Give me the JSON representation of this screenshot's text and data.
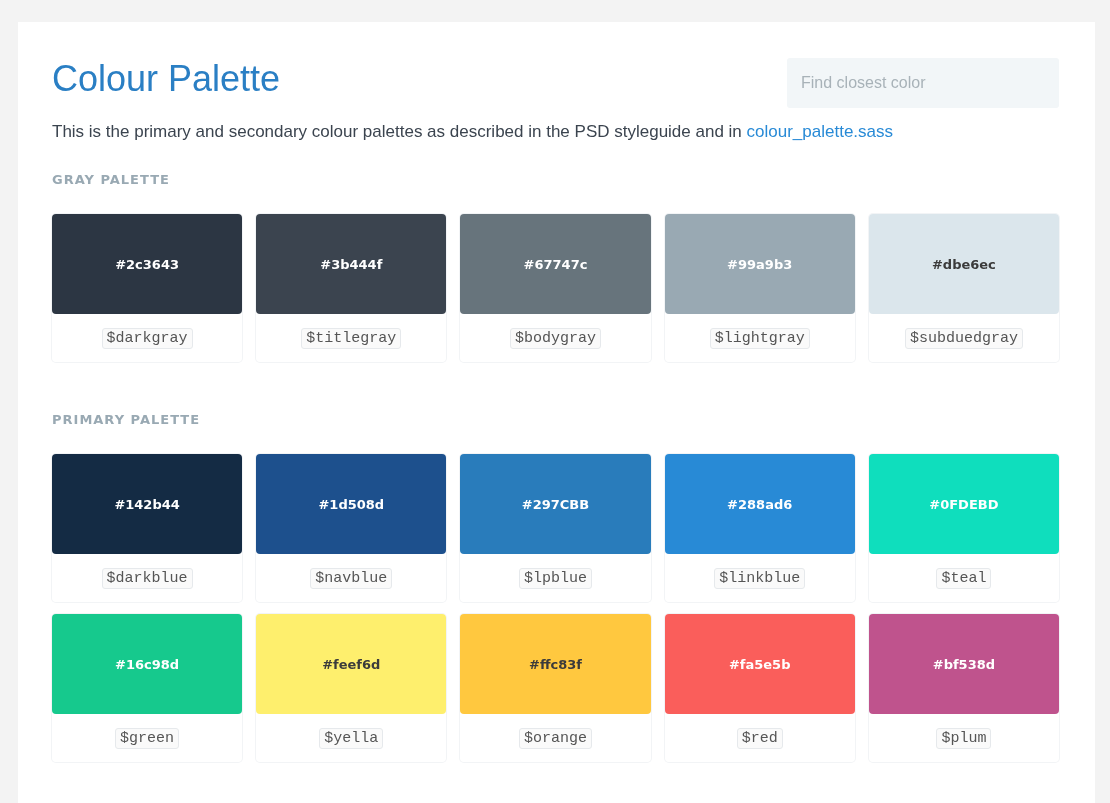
{
  "title": "Colour Palette",
  "search": {
    "placeholder": "Find closest color"
  },
  "intro": {
    "text": "This is the primary and secondary colour palettes as described in the PSD styleguide and in",
    "link": "colour_palette.sass"
  },
  "palettes": [
    {
      "heading": "GRAY PALETTE",
      "swatches": [
        {
          "hex": "#2c3643",
          "variable": "$darkgray",
          "color": "#2c3643"
        },
        {
          "hex": "#3b444f",
          "variable": "$titlegray",
          "color": "#3b444f"
        },
        {
          "hex": "#67747c",
          "variable": "$bodygray",
          "color": "#67747c"
        },
        {
          "hex": "#99a9b3",
          "variable": "$lightgray",
          "color": "#99a9b3"
        },
        {
          "hex": "#dbe6ec",
          "variable": "$subduedgray",
          "color": "#dbe6ec"
        }
      ]
    },
    {
      "heading": "PRIMARY PALETTE",
      "swatches": [
        {
          "hex": "#142b44",
          "variable": "$darkblue",
          "color": "#142b44"
        },
        {
          "hex": "#1d508d",
          "variable": "$navblue",
          "color": "#1d508d"
        },
        {
          "hex": "#297CBB",
          "variable": "$lpblue",
          "color": "#297cbb"
        },
        {
          "hex": "#288ad6",
          "variable": "$linkblue",
          "color": "#288ad6"
        },
        {
          "hex": "#0FDEBD",
          "variable": "$teal",
          "color": "#0fdebd"
        },
        {
          "hex": "#16c98d",
          "variable": "$green",
          "color": "#16c98d"
        },
        {
          "hex": "#feef6d",
          "variable": "$yella",
          "color": "#feef6d"
        },
        {
          "hex": "#ffc83f",
          "variable": "$orange",
          "color": "#ffc83f"
        },
        {
          "hex": "#fa5e5b",
          "variable": "$red",
          "color": "#fa5e5b"
        },
        {
          "hex": "#bf538d",
          "variable": "$plum",
          "color": "#bf538d"
        }
      ]
    }
  ]
}
